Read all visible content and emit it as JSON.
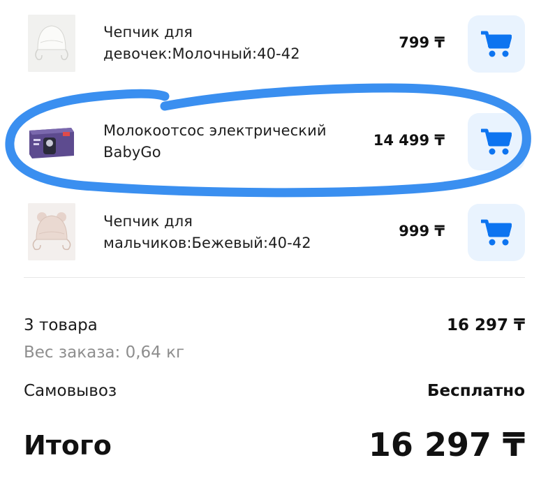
{
  "items": [
    {
      "name": "Чепчик для девочек:Молочный:40-42",
      "price": "799 ₸",
      "thumb_icon": "baby-bonnet-icon",
      "thumb_color": "#f4f3ef"
    },
    {
      "name": "Молокоотсос электрический BabyGo",
      "price": "14 499 ₸",
      "thumb_icon": "breast-pump-box-icon",
      "thumb_color": "#5b4a8a"
    },
    {
      "name": "Чепчик для мальчиков:Бежевый:40-42",
      "price": "999 ₸",
      "thumb_icon": "baby-bonnet-icon",
      "thumb_color": "#e5d4cc"
    }
  ],
  "summary": {
    "items_count": "3 товара",
    "items_total": "16 297 ₸",
    "weight": "Вес заказа: 0,64 кг",
    "delivery_label": "Самовывоз",
    "delivery_value": "Бесплатно",
    "total_label": "Итого",
    "total_value": "16 297 ₸"
  },
  "cart_button_icon": "cart-icon",
  "colors": {
    "accent": "#0d74f0",
    "cart_button_bg": "#e9f3fe",
    "highlight_stroke": "#3a8ff0"
  }
}
